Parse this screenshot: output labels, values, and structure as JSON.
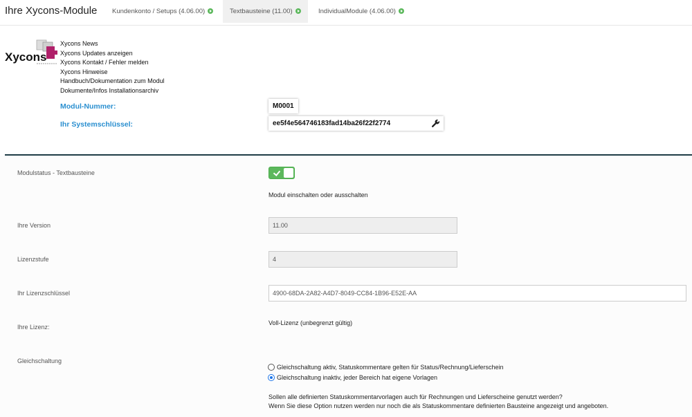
{
  "header": {
    "title": "Ihre Xycons-Module",
    "tabs": [
      {
        "label": "Kundenkonto / Setups (4.06.00)",
        "active": false
      },
      {
        "label": "Textbausteine (11.00)",
        "active": true
      },
      {
        "label": "IndividualModule (4.06.00)",
        "active": false
      }
    ]
  },
  "logo": {
    "text": "Xycons",
    "icon": "puzzle-logo-icon"
  },
  "links": [
    "Xycons News",
    "Xycons Updates anzeigen",
    "Xycons Kontakt / Fehler melden",
    "Xycons Hinweise",
    "Handbuch/Dokumentation zum Modul",
    "Dokumente/Infos Installationsarchiv"
  ],
  "module": {
    "number_label": "Modul-Nummer:",
    "number_value": "M0001",
    "key_label": "Ihr Systemschlüssel:",
    "key_value": "ee5f4e564746183fad14ba26f22f2774",
    "key_icon": "wrench-icon"
  },
  "form": {
    "status_label": "Modulstatus - Textbausteine",
    "status_on": true,
    "status_help": "Modul einschalten oder ausschalten",
    "version_label": "Ihre Version",
    "version_value": "11.00",
    "level_label": "Lizenzstufe",
    "level_value": "4",
    "license_key_label": "Ihr Lizenzschlüssel",
    "license_key_value": "4900-68DA-2A82-A4D7-8049-CC84-1B96-E52E-AA",
    "license_label": "Ihre Lizenz:",
    "license_value": "Voll-Lizenz (unbegrenzt gültig)",
    "sync_label": "Gleichschaltung",
    "sync_options": [
      {
        "label": "Gleichschaltung aktiv, Statuskommentare gelten für Status/Rechnung/Lieferschein",
        "selected": false
      },
      {
        "label": "Gleichschaltung inaktiv, jeder Bereich hat eigene Vorlagen",
        "selected": true
      }
    ],
    "sync_help_1": "Sollen alle definierten Statuskommentarvorlagen auch für Rechnungen und Lieferscheine genutzt werden?",
    "sync_help_2": "Wenn Sie diese Option nutzen werden nur noch die als Statuskommentare definierten Bausteine angezeigt und angeboten."
  },
  "colors": {
    "accent_blue": "#2a8fd0",
    "toggle_green": "#5cb85c",
    "divider": "#1e3c46",
    "logo_magenta": "#b0206a"
  }
}
